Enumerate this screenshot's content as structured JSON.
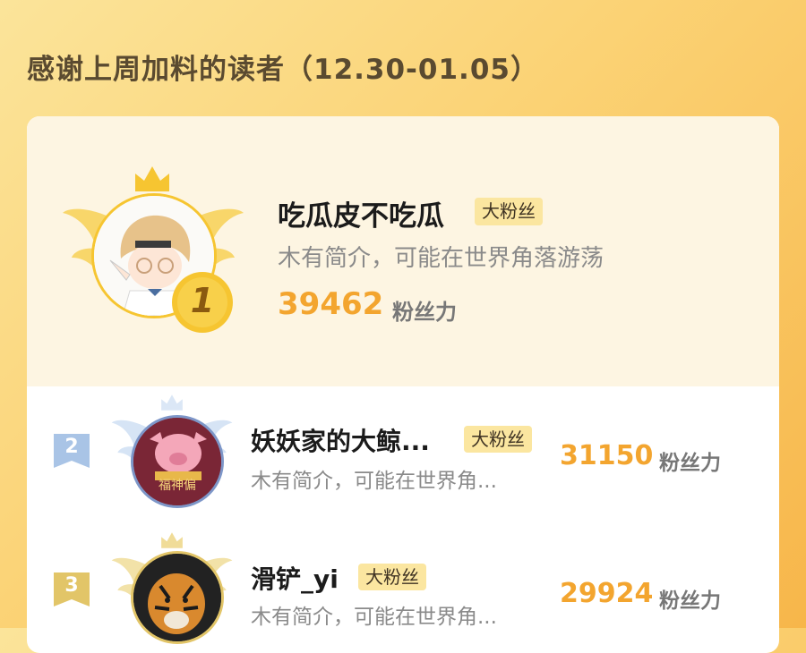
{
  "header": {
    "title": "感谢上周加料的读者（12.30-01.05）"
  },
  "ranking": [
    {
      "rank": "1",
      "name": "吃瓜皮不吃瓜",
      "badge": "大粉丝",
      "bio": "木有简介，可能在世界角落游荡",
      "score": "39462",
      "score_unit": "粉丝力",
      "avatar_icon": "anime-boy-avatar"
    },
    {
      "rank": "2",
      "name": "妖妖家的大鲸...",
      "badge": "大粉丝",
      "bio": "木有简介，可能在世界角...",
      "score": "31150",
      "score_unit": "粉丝力",
      "avatar_icon": "pink-pig-avatar",
      "avatar_text": "福神偏"
    },
    {
      "rank": "3",
      "name": "滑铲_yi",
      "badge": "大粉丝",
      "bio": "木有简介，可能在世界角...",
      "score": "29924",
      "score_unit": "粉丝力",
      "avatar_icon": "tiger-avatar"
    }
  ],
  "colors": {
    "accent": "#f3a52f",
    "gold": "#f6c531",
    "silver": "#a9c4e6",
    "bronze": "#e2c568",
    "badge_bg": "#fbe6a0"
  }
}
